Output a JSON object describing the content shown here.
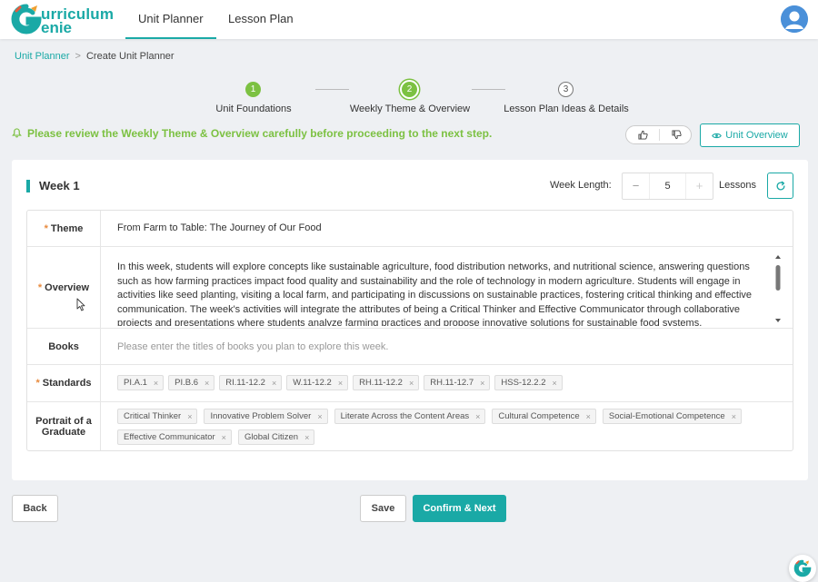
{
  "header": {
    "logo_text_1": "urriculum",
    "logo_text_2": "enie",
    "tabs": [
      {
        "label": "Unit Planner",
        "active": true
      },
      {
        "label": "Lesson Plan",
        "active": false
      }
    ],
    "avatar_icon": "user-icon"
  },
  "breadcrumb": {
    "root": "Unit Planner",
    "separator": ">",
    "current": "Create Unit Planner"
  },
  "stepper": {
    "steps": [
      {
        "number": "1",
        "label": "Unit Foundations",
        "state": "done"
      },
      {
        "number": "2",
        "label": "Weekly Theme & Overview",
        "state": "current"
      },
      {
        "number": "3",
        "label": "Lesson Plan Ideas & Details",
        "state": "todo"
      }
    ]
  },
  "notice": {
    "text": "Please review the Weekly Theme & Overview carefully before proceeding to the next step.",
    "icon": "bell-icon"
  },
  "actions": {
    "unit_overview_label": "Unit Overview",
    "back_label": "Back",
    "save_label": "Save",
    "confirm_label": "Confirm & Next"
  },
  "week": {
    "title": "Week 1",
    "length_label": "Week Length:",
    "length_value": "5",
    "minus": "−",
    "plus": "+",
    "lessons_label": "Lessons"
  },
  "form": {
    "theme": {
      "label": "Theme",
      "required": "*",
      "value": "From Farm to Table: The Journey of Our Food"
    },
    "overview": {
      "label": "Overview",
      "required": "*",
      "value": "In this week, students will explore concepts like sustainable agriculture, food distribution networks, and nutritional science, answering questions such as how farming practices impact food quality and sustainability and the role of technology in modern agriculture. Students will engage in activities like seed planting, visiting a local farm, and participating in discussions on sustainable practices, fostering critical thinking and effective communication. The week's activities will integrate the attributes of being a Critical Thinker and Effective Communicator through collaborative projects and presentations where students analyze farming practices and propose innovative solutions for sustainable food systems. Additionally"
    },
    "books": {
      "label": "Books",
      "placeholder": "Please enter the titles of books you plan to explore this week."
    },
    "standards": {
      "label": "Standards",
      "required": "*",
      "tags": [
        "PI.A.1",
        "PI.B.6",
        "RI.11-12.2",
        "W.11-12.2",
        "RH.11-12.2",
        "RH.11-12.7",
        "HSS-12.2.2"
      ]
    },
    "portrait": {
      "label_line1": "Portrait of a",
      "label_line2": "Graduate",
      "tags": [
        "Critical Thinker",
        "Innovative Problem Solver",
        "Literate Across the Content Areas",
        "Cultural Competence",
        "Social-Emotional Competence",
        "Effective Communicator",
        "Global Citizen"
      ]
    },
    "tag_remove": "×"
  },
  "colors": {
    "accent": "#1aa9a6",
    "success": "#7cc142",
    "required": "#e88a3d"
  }
}
